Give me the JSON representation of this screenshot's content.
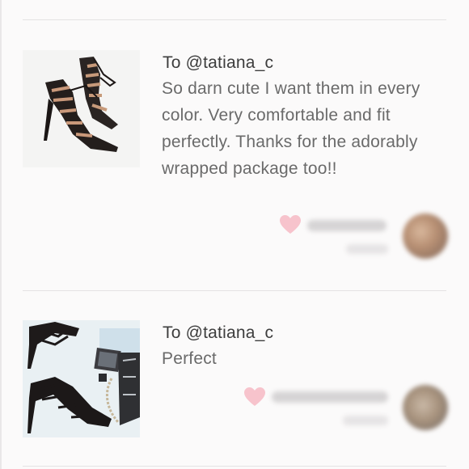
{
  "reviews": [
    {
      "to_label": "To @tatiana_c",
      "text": "So darn cute I want them in every color. Very comfortable and fit perfectly. Thanks for the adorably wrapped package too!!",
      "liked": true
    },
    {
      "to_label": "To @tatiana_c",
      "text": "Perfect",
      "liked": true
    }
  ],
  "colors": {
    "heart": "#f7c3cc",
    "divider": "#e4e2e3",
    "text_primary": "#3d3d3d",
    "text_secondary": "#6a6a6a"
  }
}
